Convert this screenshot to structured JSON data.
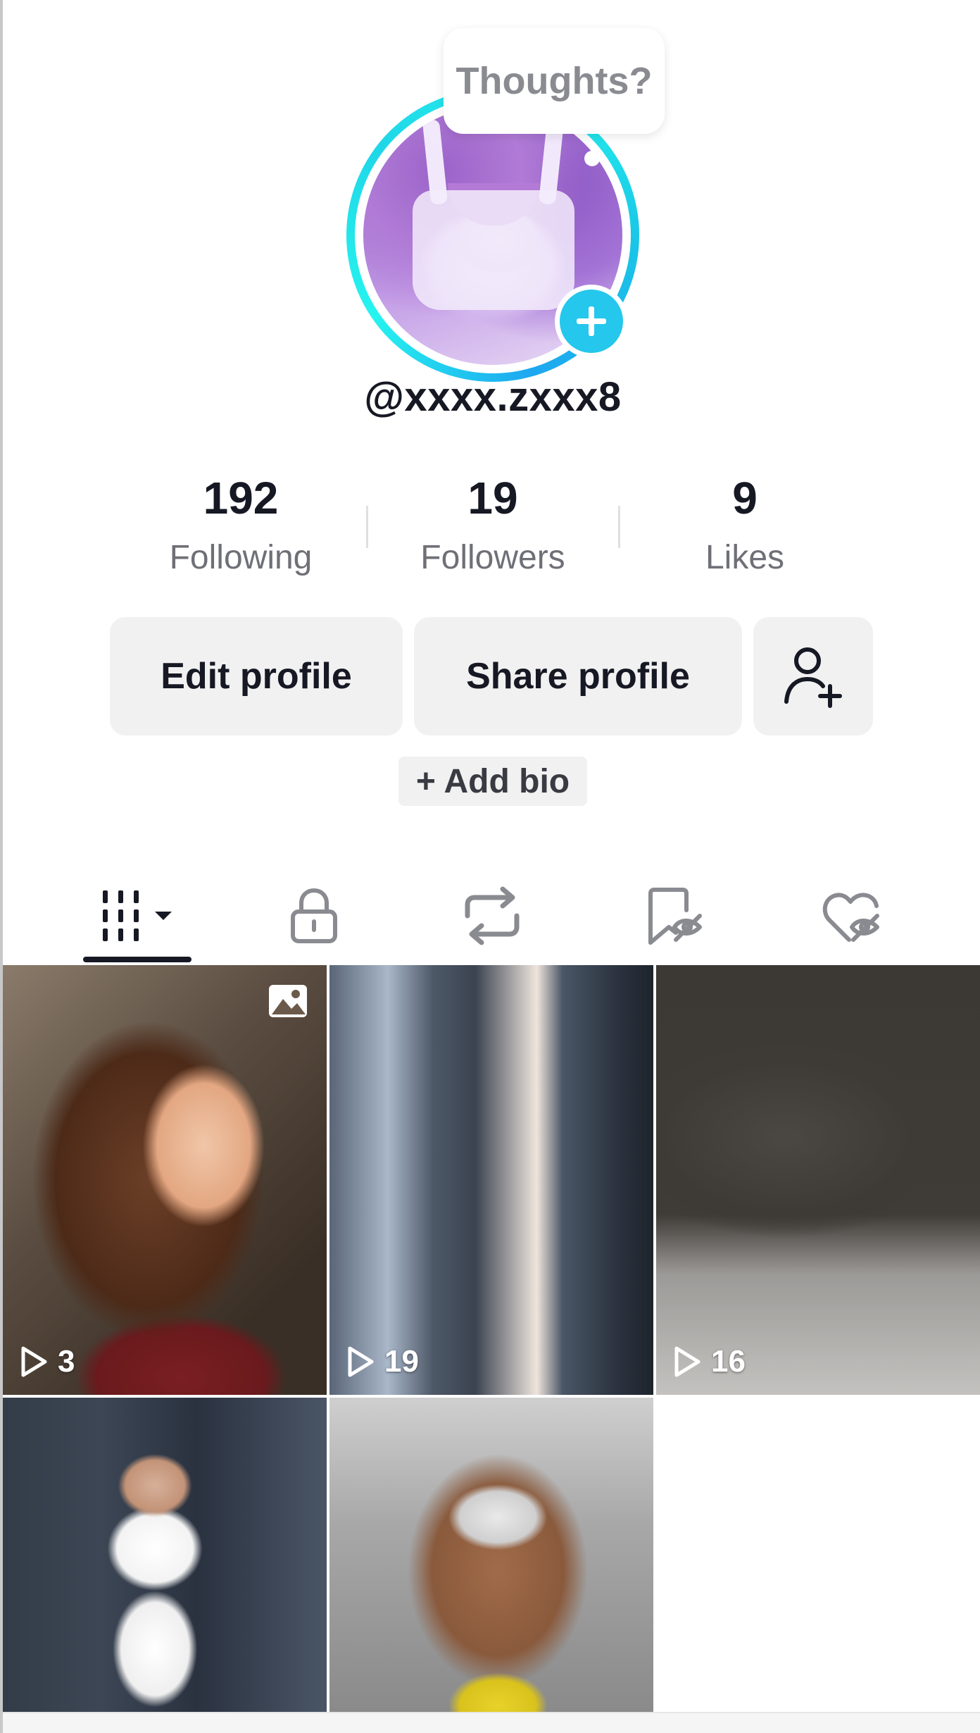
{
  "profile": {
    "tooltip": "Thoughts?",
    "username": "@xxxx.zxxx8"
  },
  "stats": [
    {
      "value": "192",
      "label": "Following"
    },
    {
      "value": "19",
      "label": "Followers"
    },
    {
      "value": "9",
      "label": "Likes"
    }
  ],
  "actions": {
    "edit_profile": "Edit profile",
    "share_profile": "Share profile",
    "add_bio": "+ Add bio"
  },
  "tabs": [
    {
      "icon": "grid-videos-icon",
      "active": true
    },
    {
      "icon": "lock-icon",
      "active": false
    },
    {
      "icon": "repost-icon",
      "active": false
    },
    {
      "icon": "favorites-hidden-icon",
      "active": false
    },
    {
      "icon": "liked-hidden-icon",
      "active": false
    }
  ],
  "videos": [
    {
      "views": "3",
      "type": "photo"
    },
    {
      "views": "19",
      "type": "video"
    },
    {
      "views": "16",
      "type": "video"
    },
    {
      "views": "",
      "type": "video"
    },
    {
      "views": "",
      "type": "video"
    }
  ],
  "colors": {
    "accent": "#25c7ec",
    "text": "#161823",
    "muted": "#6f7077",
    "button_bg": "#f1f1f2"
  }
}
